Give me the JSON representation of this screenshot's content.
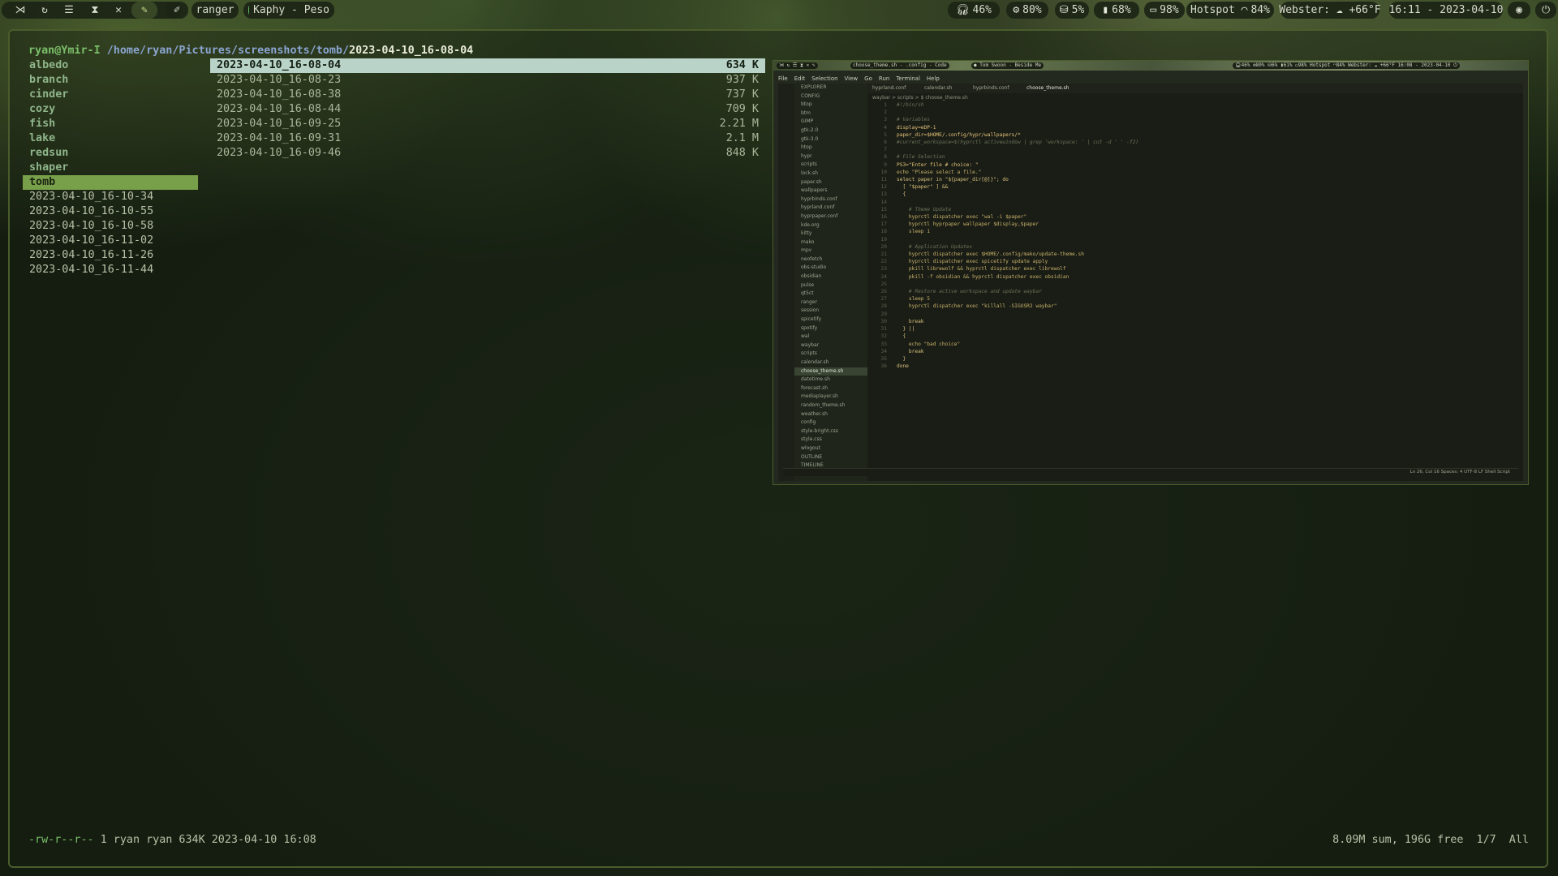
{
  "topbar": {
    "workspace_icons": [
      "arch-logo-icon",
      "refresh-icon",
      "spotify-icon",
      "hourglass-icon",
      "crossed-tools-icon",
      "pen-icon"
    ],
    "ranger_label": "ranger",
    "media_label": "Kaphy - Peso",
    "headphones_label": "46%",
    "cpu_label": "80%",
    "disk_label": "5%",
    "memory_label": "68%",
    "battery_label": "98%",
    "network_label": "Hotspot",
    "wifi_label": "84%",
    "weather_label": "Webster: ☁ +66°F",
    "clock_label": "16:11 - 2023-04-10"
  },
  "terminal": {
    "user_host": "ryan@Ymir-I",
    "path_dir": "/home/ryan/Pictures/screenshots/tomb/",
    "path_file": "2023-04-10_16-08-04",
    "parent_dirs": [
      "albedo",
      "branch",
      "cinder",
      "cozy",
      "fish",
      "lake",
      "redsun",
      "shaper",
      "tomb"
    ],
    "parent_files": [
      "2023-04-10_16-10-34",
      "2023-04-10_16-10-55",
      "2023-04-10_16-10-58",
      "2023-04-10_16-11-02",
      "2023-04-10_16-11-26",
      "2023-04-10_16-11-44"
    ],
    "files": [
      {
        "name": "2023-04-10_16-08-04",
        "size": "634 K"
      },
      {
        "name": "2023-04-10_16-08-23",
        "size": "937 K"
      },
      {
        "name": "2023-04-10_16-08-38",
        "size": "737 K"
      },
      {
        "name": "2023-04-10_16-08-44",
        "size": "709 K"
      },
      {
        "name": "2023-04-10_16-09-25",
        "size": "2.21 M"
      },
      {
        "name": "2023-04-10_16-09-31",
        "size": "2.1 M"
      },
      {
        "name": "2023-04-10_16-09-46",
        "size": "848 K"
      }
    ],
    "perm_string": "-rw-r--r--",
    "file_info": " 1 ryan ryan 634K 2023-04-10 16:08",
    "stats": "8.09M sum, 196G free  1/7  All"
  },
  "preview": {
    "menu": [
      "File",
      "Edit",
      "Selection",
      "View",
      "Go",
      "Run",
      "Terminal",
      "Help"
    ],
    "tabs": [
      "hyprland.conf",
      "calendar.sh",
      "hyprbinds.conf",
      "choose_theme.sh"
    ],
    "breadcrumb": "waybar > scripts > $ choose_theme.sh",
    "explorer": [
      "EXPLORER",
      "CONFIG",
      "btop",
      "btm",
      "GIMP",
      "gtk-2.0",
      "gtk-3.0",
      "htop",
      "hypr",
      "scripts",
      "lock.sh",
      "paper.sh",
      "wallpapers",
      "hyprbinds.conf",
      "hyprland.conf",
      "hyprpaper.conf",
      "kde.org",
      "kitty",
      "mako",
      "mpv",
      "neofetch",
      "obs-studio",
      "obsidian",
      "pulse",
      "qt5ct",
      "ranger",
      "session",
      "spicetify",
      "spotify",
      "wal",
      "waybar",
      "scripts",
      "calendar.sh",
      "choose_theme.sh",
      "datetime.sh",
      "forecast.sh",
      "mediaplayer.sh",
      "random_theme.sh",
      "weather.sh",
      "config",
      "style-bright.css",
      "style.css",
      "wlogout",
      "OUTLINE",
      "TIMELINE"
    ],
    "code": [
      "#!/bin/sh",
      "",
      "# Variables",
      "display=eDP-1",
      "paper_dir=$HOME/.config/hypr/wallpapers/*",
      "#current_workspace=$(hyprctl activewindow | grep 'workspace: ' | cut -d ' ' -f2)",
      "",
      "# File Selection",
      "PS3=\"Enter file # choice: \"",
      "echo \"Please select a file.\"",
      "select paper in \"${paper_dir[@]}\"; do",
      "  [ \"$paper\" ] &&",
      "  {",
      "",
      "    # Theme Update",
      "    hyprctl dispatcher exec \"wal -i $paper\"",
      "    hyprctl hyprpaper wallpaper $display,$paper",
      "    sleep 1",
      "",
      "    # Application Updates",
      "    hyprctl dispatcher exec $HOME/.config/mako/update-theme.sh",
      "    hyprctl dispatcher exec spicetify update apply",
      "    pkill librewolf && hyprctl dispatcher exec librewolf",
      "    pkill -f obsidian && hyprctl dispatcher exec obsidian",
      "",
      "    # Restore active workspace and update waybar",
      "    sleep 5",
      "    hyprctl dispatcher exec \"killall -SIGUSR2 waybar\"",
      "",
      "    break",
      "  } ||",
      "  {",
      "    echo \"bad choice\"",
      "    break",
      "  }",
      "done"
    ],
    "status_right": "Ln 26, Col 16   Spaces: 4   UTF-8   LF   Shell Script"
  }
}
